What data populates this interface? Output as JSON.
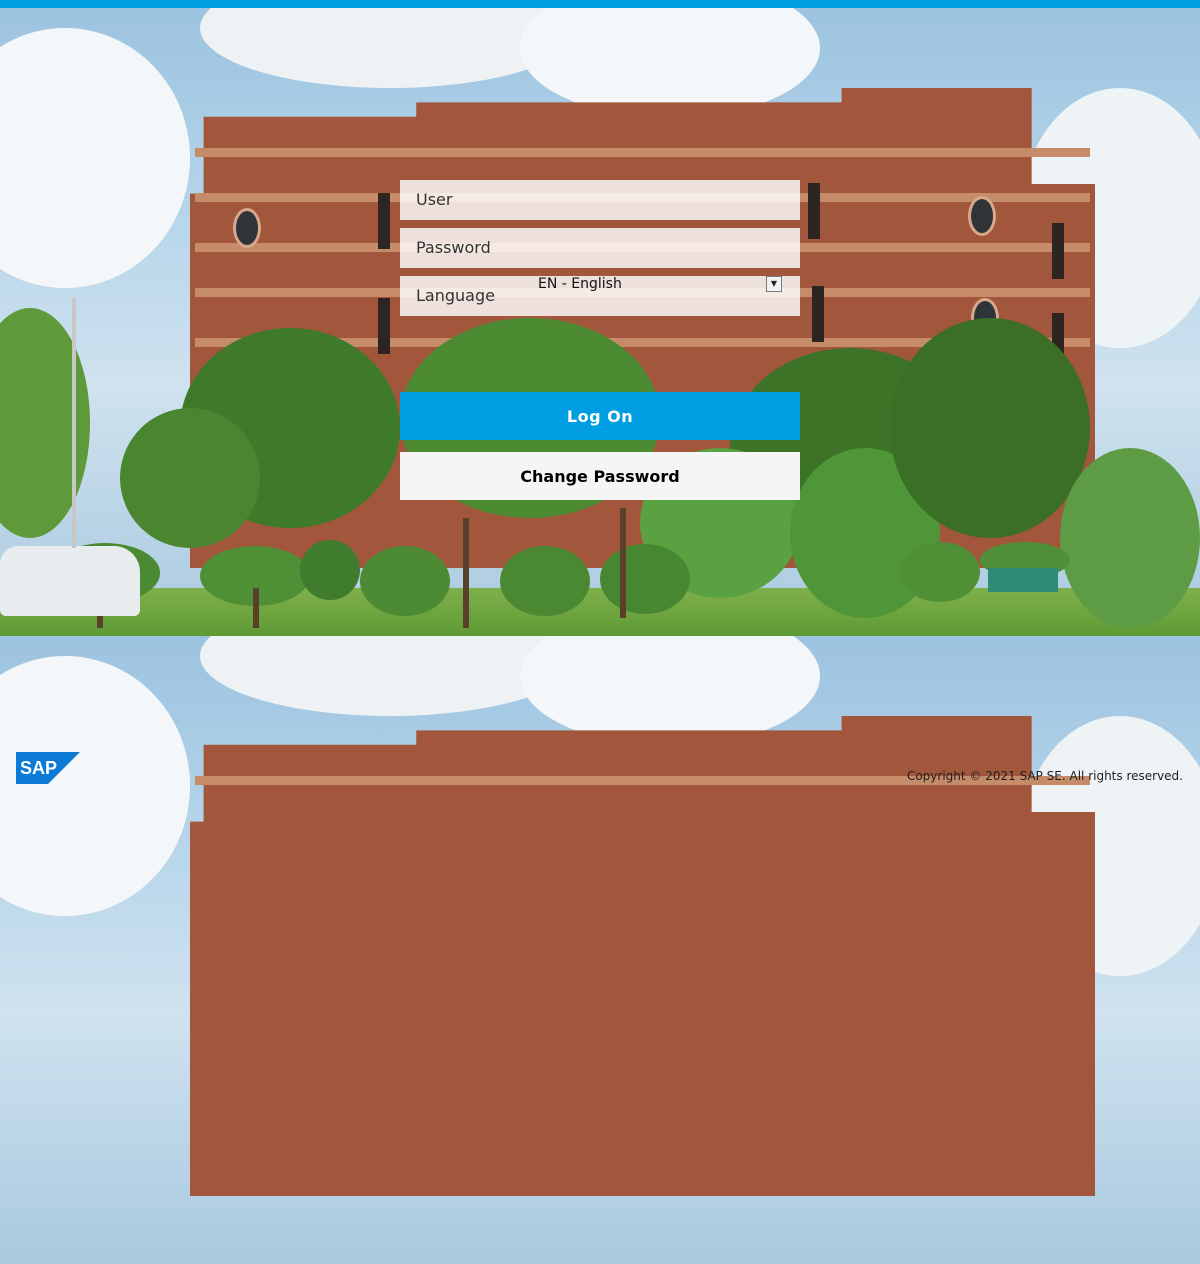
{
  "colors": {
    "accent": "#009de0",
    "button_secondary_bg": "#f5f5f5",
    "logo_blue": "#0a7ad4"
  },
  "login": {
    "user_label": "User",
    "password_label": "Password",
    "language_label": "Language",
    "language_selected": "EN - English",
    "logon_button": "Log On",
    "change_password_button": "Change Password"
  },
  "footer": {
    "logo_text": "SAP",
    "copyright": "Copyright © 2021 SAP SE. All rights reserved."
  },
  "icons": {
    "dropdown": "chevron-down-icon",
    "logo": "sap-logo"
  }
}
